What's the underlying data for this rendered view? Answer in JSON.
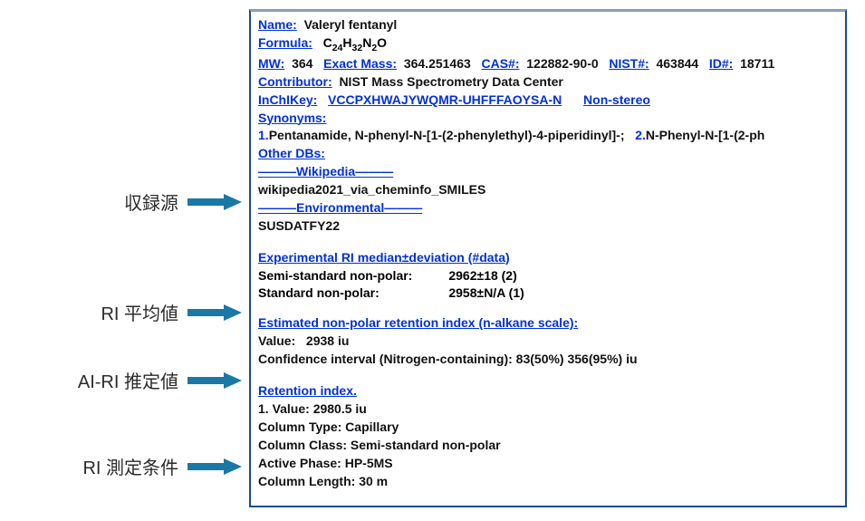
{
  "labels": {
    "source": "収録源",
    "riMean": "RI 平均値",
    "aiRi": "AI-RI 推定値",
    "riCond": "RI 測定条件"
  },
  "panel": {
    "nameLabel": "Name:",
    "nameValue": "Valeryl fentanyl",
    "formulaLabel": "Formula:",
    "formulaParts": {
      "c": "C",
      "cN": "24",
      "h": "H",
      "hN": "32",
      "n": "N",
      "nN": "2",
      "o": "O"
    },
    "mwLabel": "MW:",
    "mwValue": "364",
    "exactMassLabel": "Exact Mass:",
    "exactMassValue": "364.251463",
    "casLabel": "CAS#:",
    "casValue": "122882-90-0",
    "nistLabel": "NIST#:",
    "nistValue": "463844",
    "idLabel": "ID#:",
    "idValue": "18711",
    "contributorLabel": "Contributor:",
    "contributorValue": "NIST Mass Spectrometry Data Center",
    "inchiLabel": "InChIKey:",
    "inchiValue": "VCCPXHWAJYWQMR-UHFFFAOYSA-N",
    "nonStereo": "Non-stereo",
    "synonymsLabel": "Synonyms:",
    "syn1n": "1.",
    "syn1": "Pentanamide, N-phenyl-N-[1-(2-phenylethyl)-4-piperidinyl]-;",
    "syn2n": "2.",
    "syn2": "N-Phenyl-N-[1-(2-ph",
    "otherDbsLabel": "Other DBs:",
    "wikiHeader": "———Wikipedia———",
    "wikiVal": "wikipedia2021_via_cheminfo_SMILES",
    "envHeader": "———Environmental———",
    "envVal": "SUSDATFY22",
    "expRiLabel": "Experimental RI median±deviation (#data)",
    "expRi1k": "Semi-standard non-polar:",
    "expRi1v": "2962±18 (2)",
    "expRi2k": "Standard non-polar:",
    "expRi2v": "2958±N/A (1)",
    "estRiLabel": "Estimated non-polar retention index (n-alkane scale):",
    "estRiValK": "Value:",
    "estRiValV": "2938 iu",
    "estRiCI": "Confidence interval (Nitrogen-containing):  83(50%) 356(95%) iu",
    "retIdxLabel": "Retention index.",
    "ri1": "1. Value: 2980.5 iu",
    "colType": "Column Type: Capillary",
    "colClass": "Column Class: Semi-standard non-polar",
    "actPhase": "Active Phase: HP-5MS",
    "colLen": "Column Length: 30 m"
  }
}
